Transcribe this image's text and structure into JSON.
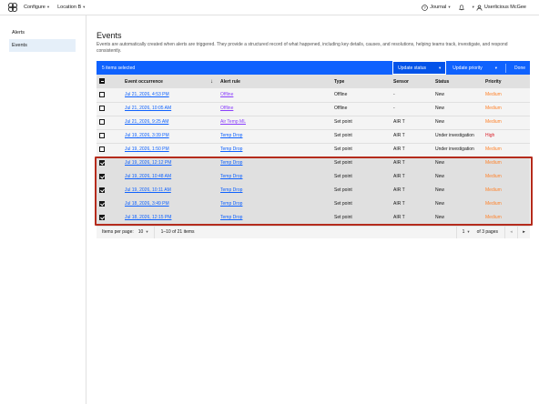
{
  "topbar": {
    "configure": "Configure",
    "location": "Location B",
    "journal": "Journal",
    "user": "Userlicious McGee"
  },
  "sidebar": {
    "items": [
      {
        "label": "Alerts"
      },
      {
        "label": "Events"
      }
    ]
  },
  "page": {
    "title": "Events",
    "description": "Events are automatically created when alerts are triggered. They provide a structured record of what happened, including key details, causes, and resolutions, helping teams track, investigate, and respond consistently."
  },
  "batch": {
    "selected": "5 items selected",
    "update_status": "Update status",
    "update_priority": "Update priority",
    "done": "Done"
  },
  "table": {
    "headers": {
      "occurrence": "Event occurrence",
      "rule": "Alert rule",
      "type": "Type",
      "sensor": "Sensor",
      "status": "Status",
      "priority": "Priority"
    },
    "rows": [
      {
        "occurrence": "Jul 21, 2026, 4:53 PM",
        "rule": "Offline",
        "type": "Offline",
        "sensor": "-",
        "status": "New",
        "priority": "Medium"
      },
      {
        "occurrence": "Jul 21, 2026, 10:05 AM",
        "rule": "Offline",
        "type": "Offline",
        "sensor": "-",
        "status": "New",
        "priority": "Medium"
      },
      {
        "occurrence": "Jul 21, 2026, 9:25 AM",
        "rule": "Air Temp ML",
        "type": "Set point",
        "sensor": "AIR T",
        "status": "New",
        "priority": "Medium"
      },
      {
        "occurrence": "Jul 19, 2026, 3:39 PM",
        "rule": "Temp Drop",
        "type": "Set point",
        "sensor": "AIR T",
        "status": "Under investigation",
        "priority": "High"
      },
      {
        "occurrence": "Jul 19, 2026, 1:50 PM",
        "rule": "Temp Drop",
        "type": "Set point",
        "sensor": "AIR T",
        "status": "Under investigation",
        "priority": "Medium"
      },
      {
        "occurrence": "Jul 19, 2026, 12:12 PM",
        "rule": "Temp Drop",
        "type": "Set point",
        "sensor": "AIR T",
        "status": "New",
        "priority": "Medium"
      },
      {
        "occurrence": "Jul 19, 2026, 10:48 AM",
        "rule": "Temp Drop",
        "type": "Set point",
        "sensor": "AIR T",
        "status": "New",
        "priority": "Medium"
      },
      {
        "occurrence": "Jul 19, 2026, 10:11 AM",
        "rule": "Temp Drop",
        "type": "Set point",
        "sensor": "AIR T",
        "status": "New",
        "priority": "Medium"
      },
      {
        "occurrence": "Jul 18, 2026, 3:49 PM",
        "rule": "Temp Drop",
        "type": "Set point",
        "sensor": "AIR T",
        "status": "New",
        "priority": "Medium"
      },
      {
        "occurrence": "Jul 18, 2026, 12:15 PM",
        "rule": "Temp Drop",
        "type": "Set point",
        "sensor": "AIR T",
        "status": "New",
        "priority": "Medium"
      }
    ]
  },
  "pagination": {
    "items_per_page_label": "Items per page:",
    "items_per_page": "10",
    "range": "1–10 of 21 items",
    "page": "1",
    "of_pages": "of 3 pages"
  },
  "colors": {
    "accent": "#0f62fe",
    "priority_medium": "#ff832b",
    "priority_high": "#da1e28",
    "highlight": "#b52b1c"
  }
}
